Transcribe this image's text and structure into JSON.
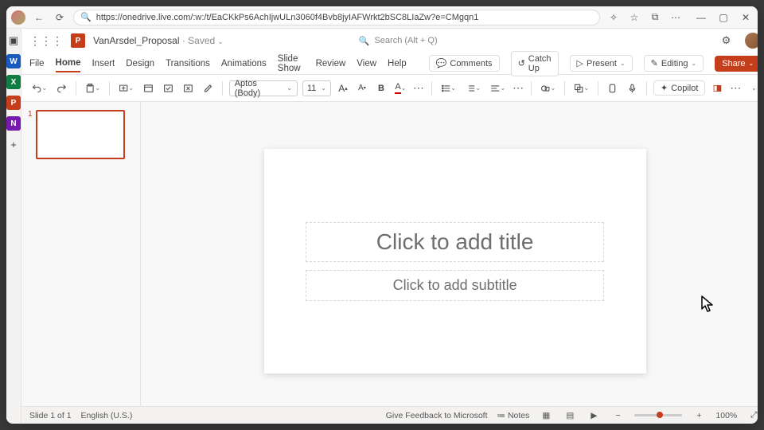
{
  "browser": {
    "url": "https://onedrive.live.com/:w:/t/EaCKkPs6AchIjwULn3060f4Bvb8jyIAFWrkt2bSC8LIaZw?e=CMgqn1"
  },
  "rail": {
    "word": "W",
    "excel": "X",
    "ppt": "P",
    "onenote": "N",
    "plus": "+"
  },
  "titlebar": {
    "app_initial": "P",
    "doc_name": "VanArsdel_Proposal",
    "saved_label": " · Saved",
    "search_placeholder": "Search (Alt + Q)"
  },
  "tabs": {
    "items": [
      "File",
      "Home",
      "Insert",
      "Design",
      "Transitions",
      "Animations",
      "Slide Show",
      "Review",
      "View",
      "Help"
    ],
    "active": "Home",
    "right": {
      "comments": "Comments",
      "catchup": "Catch Up",
      "present": "Present",
      "editing": "Editing",
      "share": "Share"
    }
  },
  "toolbar": {
    "font": "Aptos (Body)",
    "size": "11",
    "copilot": "Copilot"
  },
  "slide": {
    "title_placeholder": "Click to add title",
    "subtitle_placeholder": "Click to add subtitle",
    "thumb_number": "1"
  },
  "status": {
    "slide_count": "Slide 1 of 1",
    "language": "English (U.S.)",
    "feedback": "Give Feedback to Microsoft",
    "notes": "Notes",
    "zoom": "100%"
  }
}
